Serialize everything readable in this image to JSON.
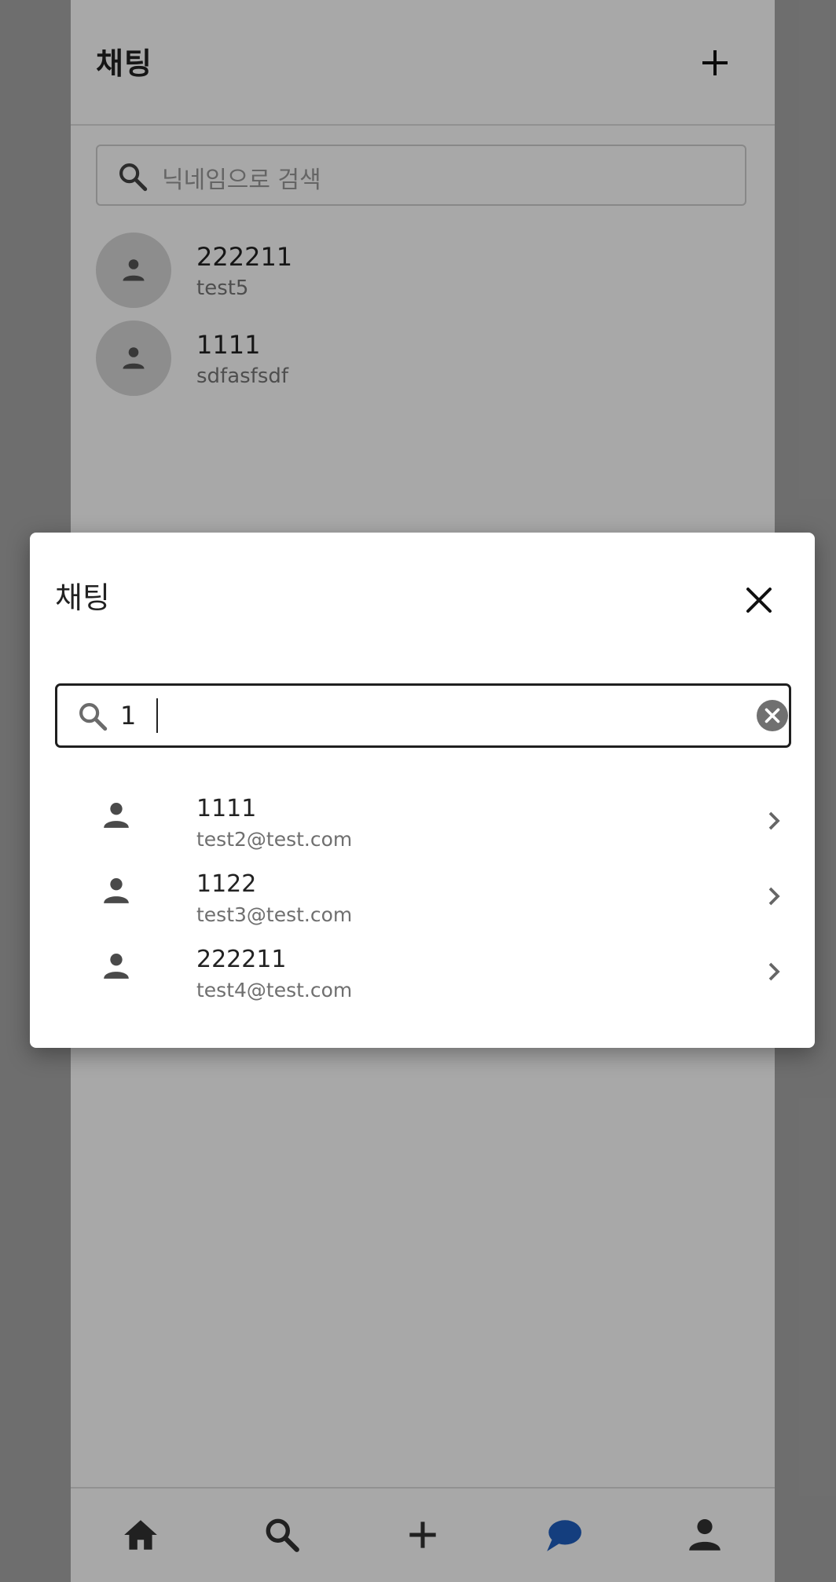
{
  "app": {
    "title": "채팅",
    "search_placeholder": "닉네임으로 검색",
    "chats": [
      {
        "name": "222211",
        "subtitle": "test5"
      },
      {
        "name": "1111",
        "subtitle": "sdfasfsdf"
      }
    ],
    "nav": [
      {
        "icon": "home-icon",
        "active": false
      },
      {
        "icon": "search-icon",
        "active": false
      },
      {
        "icon": "plus-icon",
        "active": false
      },
      {
        "icon": "chat-bubble-icon",
        "active": true
      },
      {
        "icon": "person-icon",
        "active": false
      }
    ],
    "accent_color": "#1f5fbf"
  },
  "modal": {
    "title": "채팅",
    "search_value": "1",
    "results": [
      {
        "name": "1111",
        "email": "test2@test.com"
      },
      {
        "name": "1122",
        "email": "test3@test.com"
      },
      {
        "name": "222211",
        "email": "test4@test.com"
      }
    ]
  }
}
